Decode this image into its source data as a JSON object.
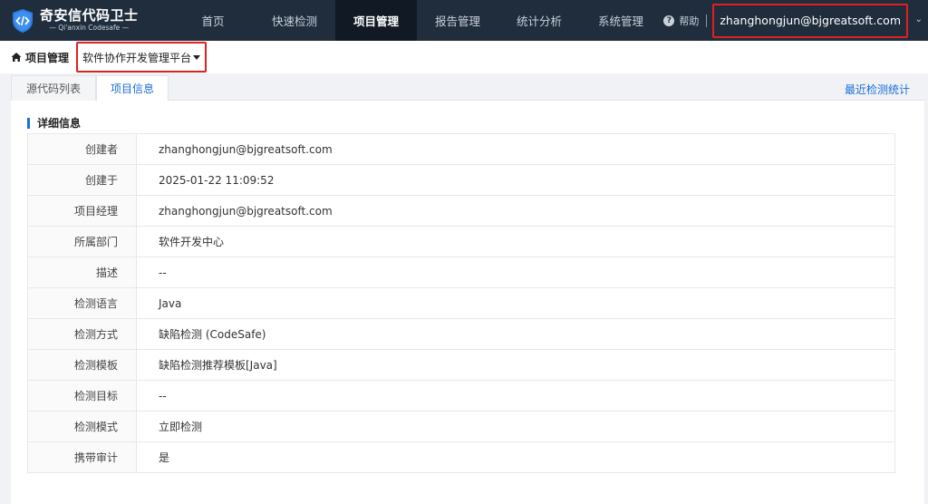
{
  "app": {
    "title": "奇安信代码卫士",
    "subtitle": "— Qi'anxin Codesafe —"
  },
  "nav": {
    "items": [
      {
        "label": "首页",
        "active": false
      },
      {
        "label": "快速检测",
        "active": false
      },
      {
        "label": "项目管理",
        "active": true
      },
      {
        "label": "报告管理",
        "active": false
      },
      {
        "label": "统计分析",
        "active": false
      },
      {
        "label": "系统管理",
        "active": false
      }
    ],
    "help_label": "帮助",
    "user": "zhanghongjun@bjgreatsoft.com"
  },
  "breadcrumb": {
    "section": "项目管理",
    "project": "软件协作开发管理平台"
  },
  "tabs": [
    {
      "label": "源代码列表",
      "active": false
    },
    {
      "label": "项目信息",
      "active": true
    }
  ],
  "recent_stats_link": "最近检测统计",
  "details": {
    "title": "详细信息",
    "rows": [
      {
        "key": "创建者",
        "value": "zhanghongjun@bjgreatsoft.com"
      },
      {
        "key": "创建于",
        "value": "2025-01-22 11:09:52"
      },
      {
        "key": "项目经理",
        "value": "zhanghongjun@bjgreatsoft.com"
      },
      {
        "key": "所属部门",
        "value": "软件开发中心"
      },
      {
        "key": "描述",
        "value": "--"
      },
      {
        "key": "检测语言",
        "value": "Java"
      },
      {
        "key": "检测方式",
        "value": "缺陷检测 (CodeSafe)"
      },
      {
        "key": "检测模板",
        "value": "缺陷检测推荐模板[Java]"
      },
      {
        "key": "检测目标",
        "value": "--"
      },
      {
        "key": "检测模式",
        "value": "立即检测"
      },
      {
        "key": "携带审计",
        "value": "是"
      }
    ]
  },
  "colors": {
    "nav_bg": "#1f2d3d",
    "accent": "#1a6ed8",
    "highlight": "#e02020"
  }
}
